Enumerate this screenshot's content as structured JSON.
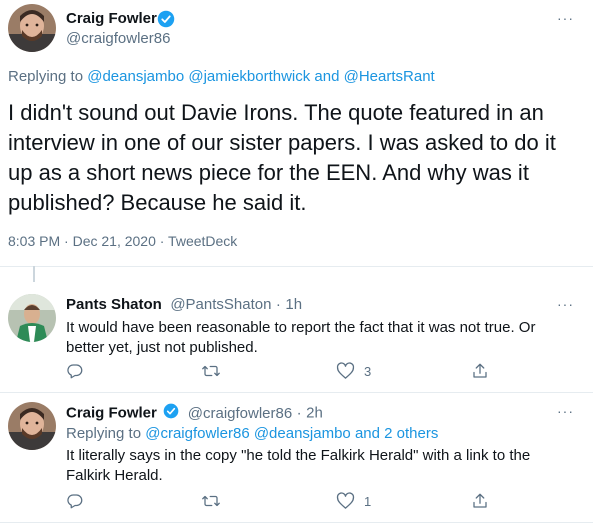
{
  "main_tweet": {
    "author_name": "Craig Fowler",
    "author_handle": "@craigfowler86",
    "replying_label": "Replying to",
    "replying_to": "@deansjambo @jamiekborthwick and @HeartsRant",
    "text": "I didn't sound out Davie Irons. The quote featured in an interview in one of our sister papers. I was asked to do it up as a short news piece for the EEN. And why was it published? Because he said it.",
    "meta": "8:03 PM · Dec 21, 2020 · TweetDeck"
  },
  "reply1": {
    "author_name": "Pants Shaton",
    "author_handle": "@PantsShaton",
    "time": "1h",
    "text": "It would have been reasonable to report the fact that it was not true. Or better yet, just not published.",
    "likes": "3"
  },
  "reply2": {
    "author_name": "Craig Fowler",
    "author_handle": "@craigfowler86",
    "time": "2h",
    "replying_label": "Replying to",
    "replying_to": "@craigfowler86 @deansjambo and 2 others",
    "text": "It literally says in the copy \"he told the Falkirk Herald\" with a link to the Falkirk Herald.",
    "likes": "1"
  },
  "separator": "·",
  "more_icon": "···",
  "colors": {
    "link": "#1b95e0",
    "verified": "#1da1f2",
    "secondary": "#5b7083",
    "divider": "#e6ecf0"
  }
}
